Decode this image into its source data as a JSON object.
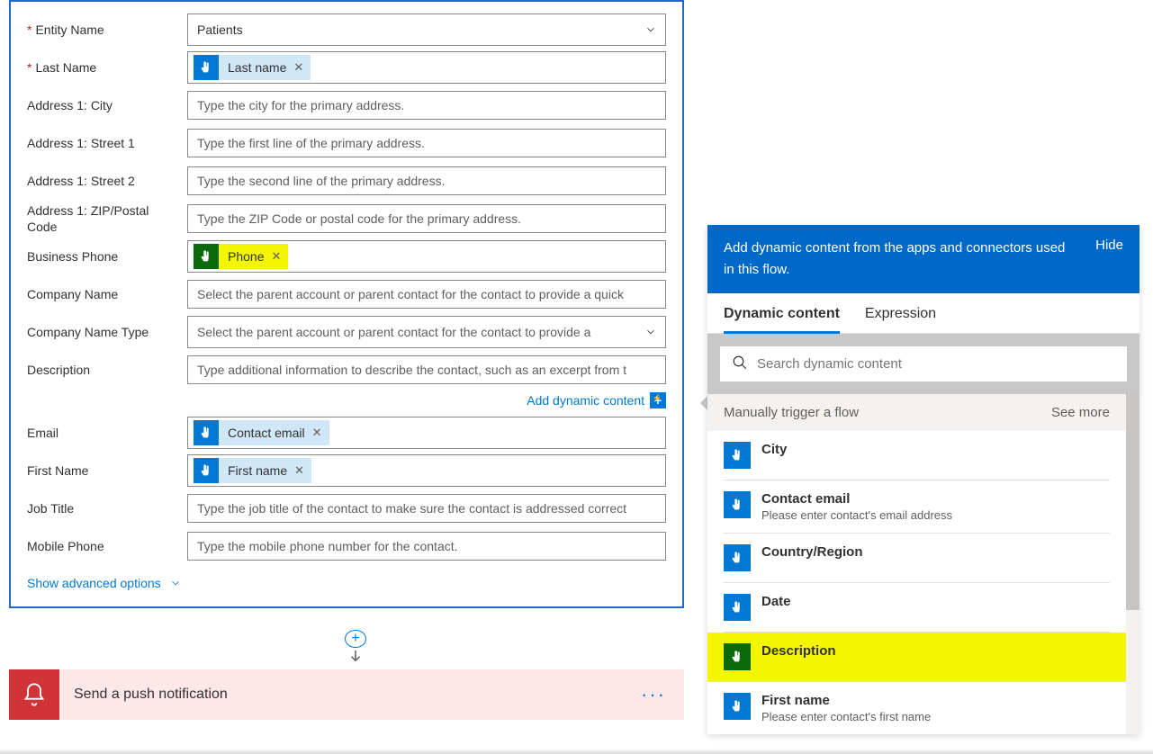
{
  "form": {
    "entity_name": {
      "label": "Entity Name",
      "value": "Patients"
    },
    "last_name": {
      "label": "Last Name",
      "token": "Last name"
    },
    "city": {
      "label": "Address 1: City",
      "placeholder": "Type the city for the primary address."
    },
    "street1": {
      "label": "Address 1: Street 1",
      "placeholder": "Type the first line of the primary address."
    },
    "street2": {
      "label": "Address 1: Street 2",
      "placeholder": "Type the second line of the primary address."
    },
    "zip": {
      "label": "Address 1: ZIP/Postal Code",
      "placeholder": "Type the ZIP Code or postal code for the primary address."
    },
    "biz_phone": {
      "label": "Business Phone",
      "token": "Phone",
      "highlight": true
    },
    "company": {
      "label": "Company Name",
      "placeholder": "Select the parent account or parent contact for the contact to provide a quick"
    },
    "company_type": {
      "label": "Company Name Type",
      "placeholder": "Select the parent account or parent contact for the contact to provide a"
    },
    "description": {
      "label": "Description",
      "placeholder": "Type additional information to describe the contact, such as an excerpt from t"
    },
    "email": {
      "label": "Email",
      "token": "Contact email"
    },
    "first_name": {
      "label": "First Name",
      "token": "First name"
    },
    "job_title": {
      "label": "Job Title",
      "placeholder": "Type the job title of the contact to make sure the contact is addressed correct"
    },
    "mobile": {
      "label": "Mobile Phone",
      "placeholder": "Type the mobile phone number for the contact."
    }
  },
  "links": {
    "add_dynamic": "Add dynamic content",
    "advanced": "Show advanced options"
  },
  "push": {
    "title": "Send a push notification"
  },
  "panel": {
    "header": "Add dynamic content from the apps and connectors used in this flow.",
    "hide": "Hide",
    "tabs": {
      "dynamic": "Dynamic content",
      "expression": "Expression"
    },
    "search_placeholder": "Search dynamic content",
    "group": "Manually trigger a flow",
    "see_more": "See more",
    "items": [
      {
        "title": "City",
        "sub": ""
      },
      {
        "title": "Contact email",
        "sub": "Please enter contact's email address"
      },
      {
        "title": "Country/Region",
        "sub": ""
      },
      {
        "title": "Date",
        "sub": ""
      },
      {
        "title": "Description",
        "sub": "",
        "highlight": true
      },
      {
        "title": "First name",
        "sub": "Please enter contact's first name"
      }
    ]
  }
}
